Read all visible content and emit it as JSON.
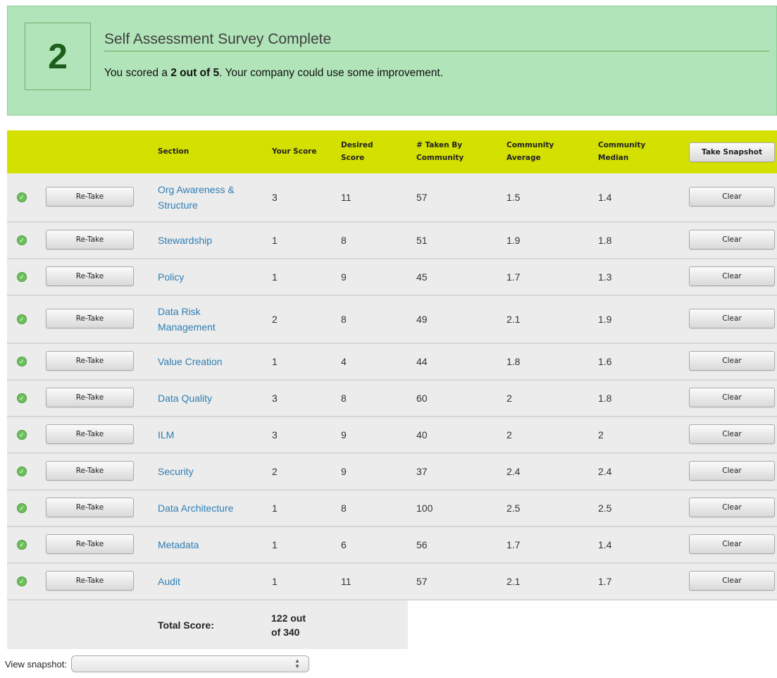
{
  "banner": {
    "score": "2",
    "title": "Self Assessment Survey Complete",
    "msg_prefix": "You scored a ",
    "msg_score": "2 out of 5",
    "msg_suffix": ". Your company could use some improvement."
  },
  "table": {
    "headers": {
      "section": "Section",
      "your_score": "Your Score",
      "desired_1": "Desired",
      "desired_2": "Score",
      "taken_1": "# Taken By",
      "taken_2": "Community",
      "avg_1": "Community",
      "avg_2": "Average",
      "median_1": "Community",
      "median_2": "Median",
      "snapshot_button": "Take Snapshot"
    },
    "retake_label": "Re-Take",
    "clear_label": "Clear",
    "rows": [
      {
        "section_1": "Org Awareness &",
        "section_2": "Structure",
        "your": "3",
        "desired": "11",
        "taken": "57",
        "avg": "1.5",
        "median": "1.4"
      },
      {
        "section_1": "Stewardship",
        "section_2": "",
        "your": "1",
        "desired": "8",
        "taken": "51",
        "avg": "1.9",
        "median": "1.8"
      },
      {
        "section_1": "Policy",
        "section_2": "",
        "your": "1",
        "desired": "9",
        "taken": "45",
        "avg": "1.7",
        "median": "1.3"
      },
      {
        "section_1": "Data Risk",
        "section_2": "Management",
        "your": "2",
        "desired": "8",
        "taken": "49",
        "avg": "2.1",
        "median": "1.9"
      },
      {
        "section_1": "Value Creation",
        "section_2": "",
        "your": "1",
        "desired": "4",
        "taken": "44",
        "avg": "1.8",
        "median": "1.6"
      },
      {
        "section_1": "Data Quality",
        "section_2": "",
        "your": "3",
        "desired": "8",
        "taken": "60",
        "avg": "2",
        "median": "1.8"
      },
      {
        "section_1": "ILM",
        "section_2": "",
        "your": "3",
        "desired": "9",
        "taken": "40",
        "avg": "2",
        "median": "2"
      },
      {
        "section_1": "Security",
        "section_2": "",
        "your": "2",
        "desired": "9",
        "taken": "37",
        "avg": "2.4",
        "median": "2.4"
      },
      {
        "section_1": "Data Architecture",
        "section_2": "",
        "your": "1",
        "desired": "8",
        "taken": "100",
        "avg": "2.5",
        "median": "2.5"
      },
      {
        "section_1": "Metadata",
        "section_2": "",
        "your": "1",
        "desired": "6",
        "taken": "56",
        "avg": "1.7",
        "median": "1.4"
      },
      {
        "section_1": "Audit",
        "section_2": "",
        "your": "1",
        "desired": "11",
        "taken": "57",
        "avg": "2.1",
        "median": "1.7"
      }
    ],
    "total_label": "Total Score:",
    "total_value_1": "122 out",
    "total_value_2": "of 340"
  },
  "snapshot": {
    "label": "View snapshot:",
    "selected": ""
  },
  "colors": {
    "banner_bg": "#b1e4b9",
    "header_bg": "#d4e000",
    "row_bg": "#ececec",
    "link": "#2f7eb3",
    "check": "#6cc05a"
  }
}
